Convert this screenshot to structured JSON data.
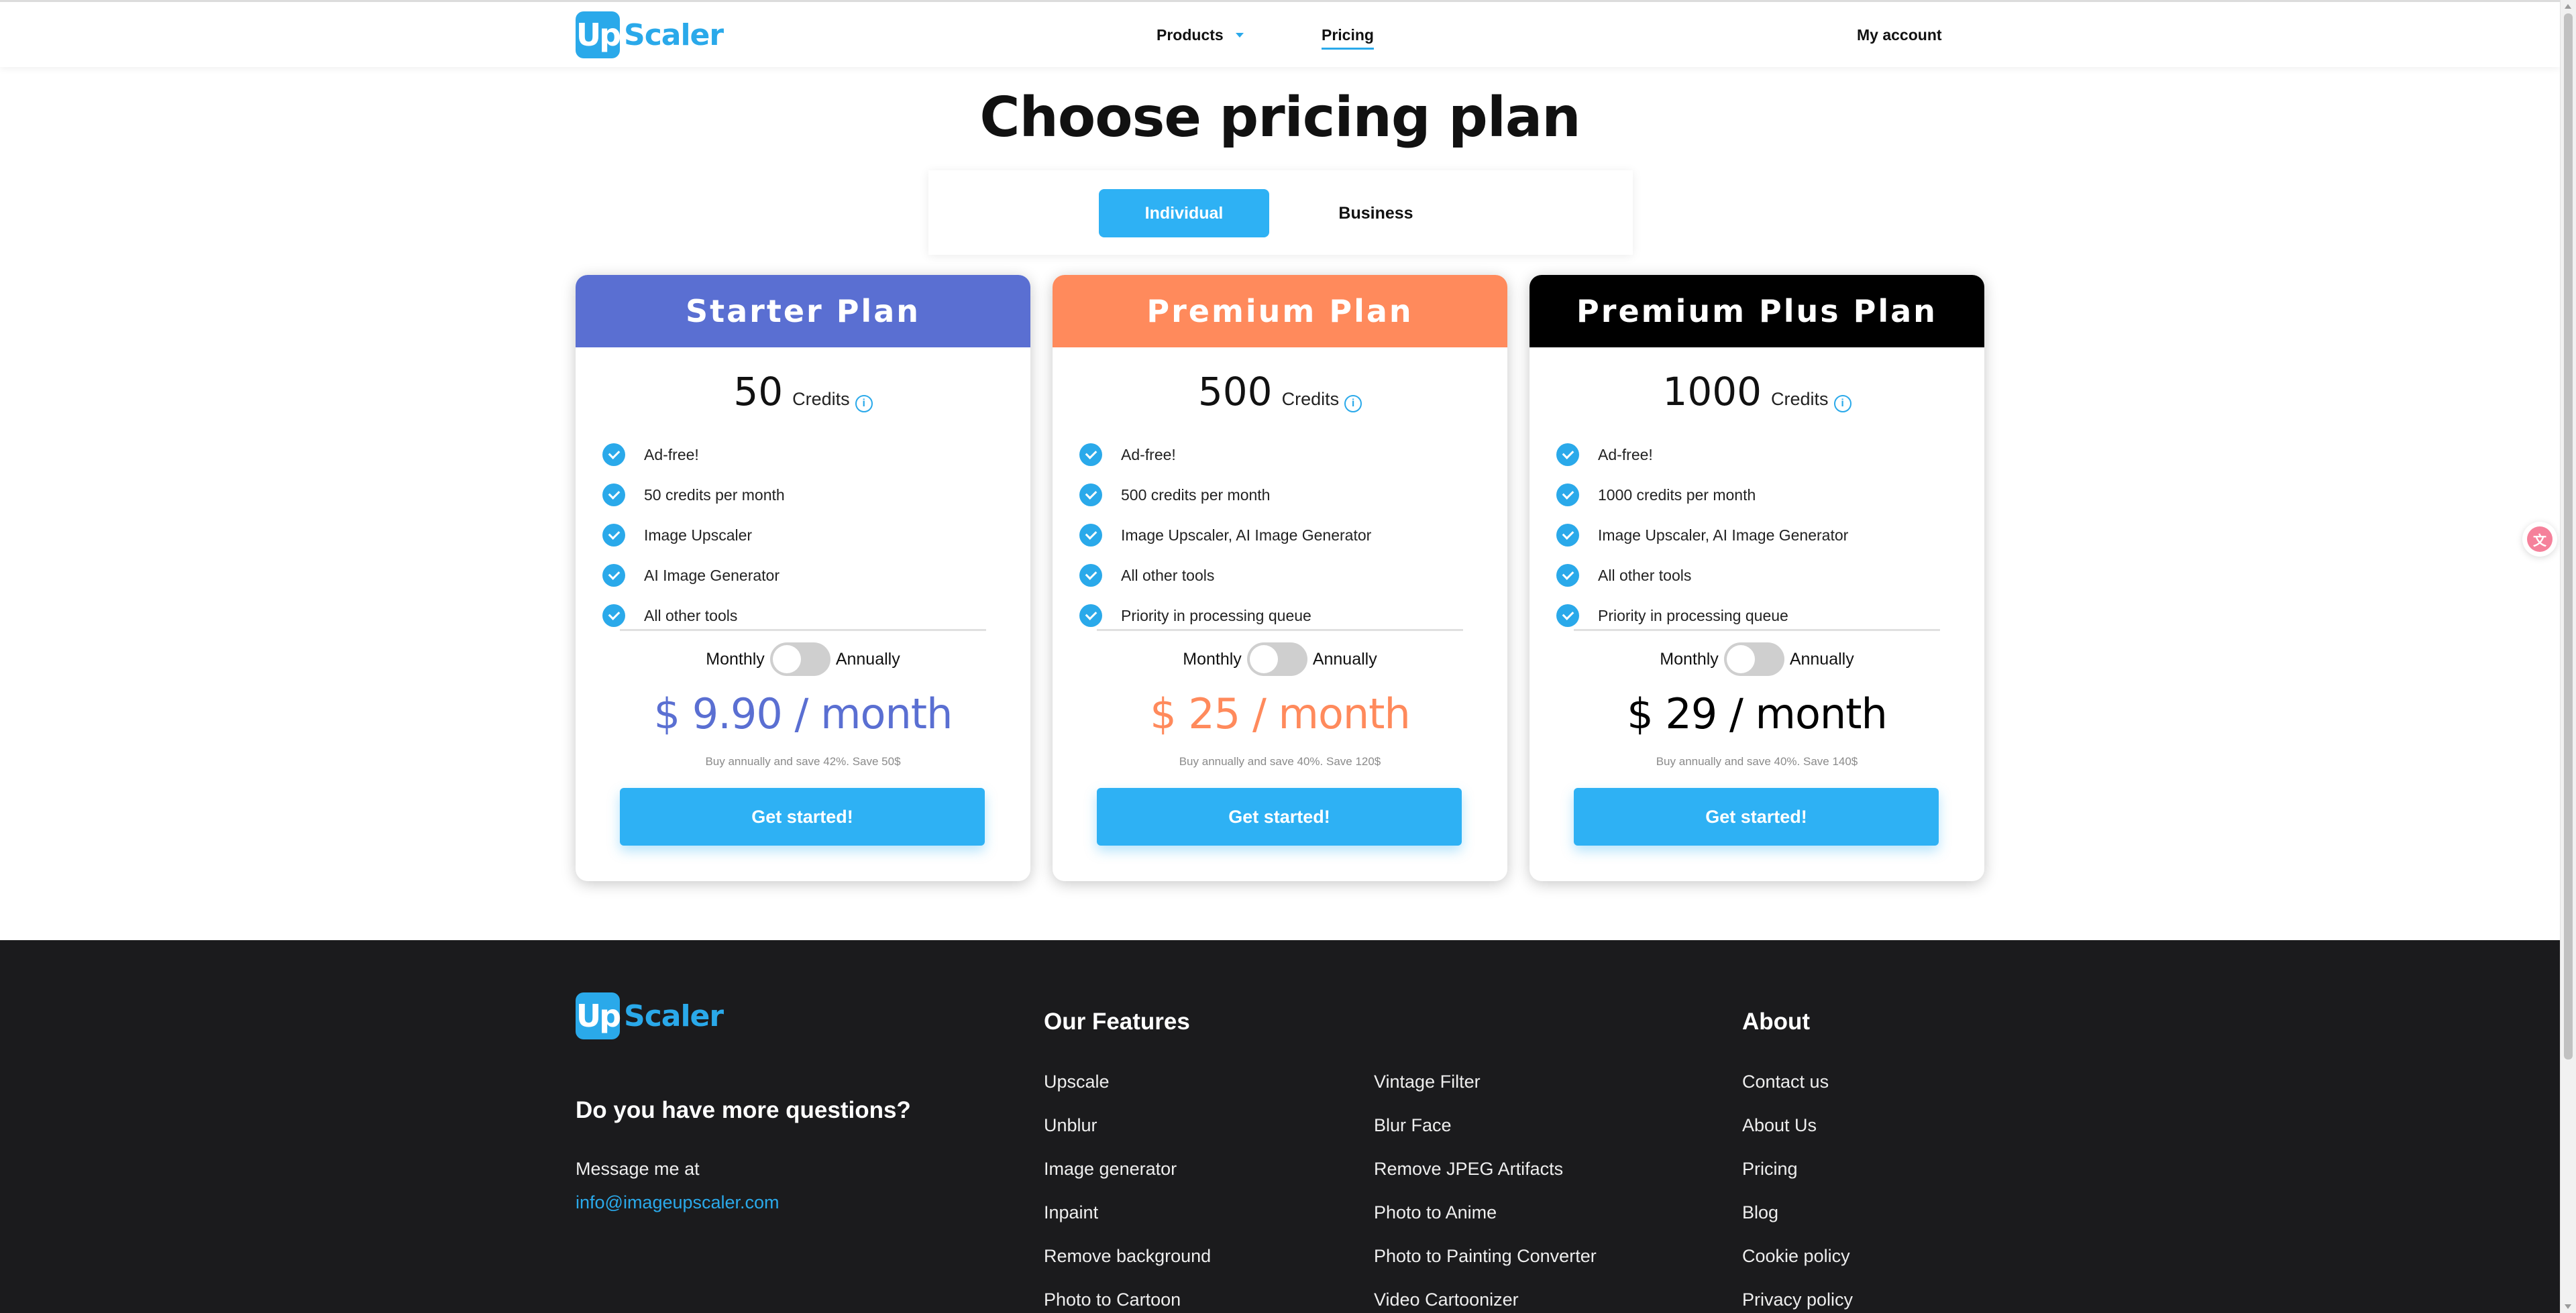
{
  "header": {
    "logo_mark": "Up",
    "logo_text": "Scaler",
    "nav": {
      "products": "Products",
      "pricing": "Pricing"
    },
    "account": "My account"
  },
  "main": {
    "title": "Choose pricing plan",
    "tabs": {
      "individual": "Individual",
      "business": "Business"
    }
  },
  "plans": [
    {
      "name": "Starter Plan",
      "color": "#5a6fd2",
      "credits": "50",
      "credits_label": "Credits",
      "features": [
        "Ad-free!",
        "50 credits per month",
        "Image Upscaler",
        "AI Image Generator",
        "All other tools"
      ],
      "monthly": "Monthly",
      "annually": "Annually",
      "price": "$ 9.90 / month",
      "price_color": "#5a6fd2",
      "save": "Buy annually and save 42%. Save 50$",
      "cta": "Get started!"
    },
    {
      "name": "Premium Plan",
      "color": "#ff8a5c",
      "credits": "500",
      "credits_label": "Credits",
      "features": [
        "Ad-free!",
        "500 credits per month",
        "Image Upscaler, AI Image Generator",
        "All other tools",
        "Priority in processing queue"
      ],
      "monthly": "Monthly",
      "annually": "Annually",
      "price": "$ 25 / month",
      "price_color": "#ff8a5c",
      "save": "Buy annually and save 40%. Save 120$",
      "cta": "Get started!"
    },
    {
      "name": "Premium Plus Plan",
      "color": "#000000",
      "credits": "1000",
      "credits_label": "Credits",
      "features": [
        "Ad-free!",
        "1000 credits per month",
        "Image Upscaler, AI Image Generator",
        "All other tools",
        "Priority in processing queue"
      ],
      "monthly": "Monthly",
      "annually": "Annually",
      "price": "$ 29 / month",
      "price_color": "#000000",
      "save": "Buy annually and save 40%. Save 140$",
      "cta": "Get started!"
    }
  ],
  "footer": {
    "logo_mark": "Up",
    "logo_text": "Scaler",
    "question": "Do you have more questions?",
    "message": "Message me at",
    "email": "info@imageupscaler.com",
    "features_heading": "Our Features",
    "features_col1": [
      "Upscale",
      "Unblur",
      "Image generator",
      "Inpaint",
      "Remove background",
      "Photo to Cartoon"
    ],
    "features_col2": [
      "Vintage Filter",
      "Blur Face",
      "Remove JPEG Artifacts",
      "Photo to Anime",
      "Photo to Painting Converter",
      "Video Cartoonizer"
    ],
    "about_heading": "About",
    "about_links": [
      "Contact us",
      "About Us",
      "Pricing",
      "Blog",
      "Cookie policy",
      "Privacy policy"
    ]
  },
  "widget": {
    "glyph": "文"
  }
}
